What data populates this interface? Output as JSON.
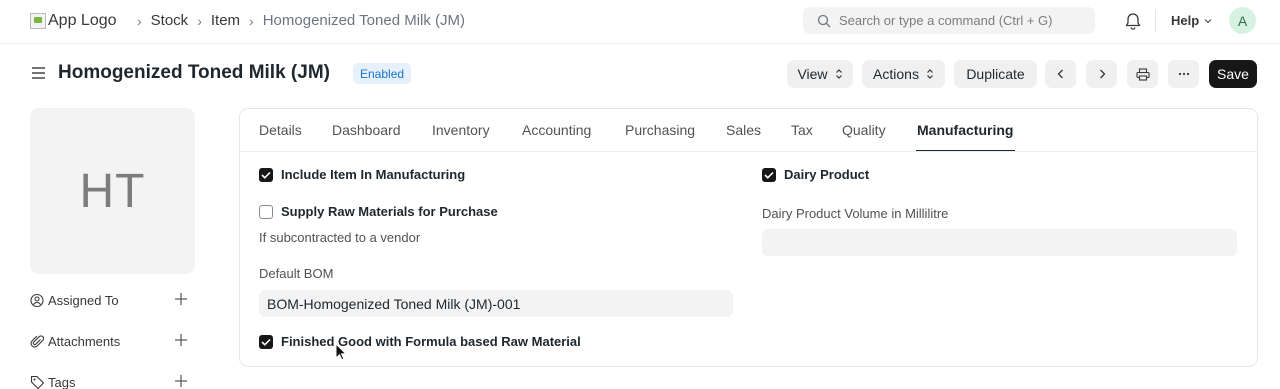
{
  "navbar": {
    "logo_alt": "App Logo",
    "breadcrumbs": [
      "Stock",
      "Item",
      "Homogenized Toned Milk (JM)"
    ],
    "search_placeholder": "Search or type a command (Ctrl + G)",
    "help_label": "Help",
    "avatar_initial": "A"
  },
  "page": {
    "title": "Homogenized Toned Milk (JM)",
    "status": "Enabled",
    "buttons": {
      "view": "View",
      "actions": "Actions",
      "duplicate": "Duplicate",
      "save": "Save"
    }
  },
  "sidebar": {
    "image_initials": "HT",
    "items": [
      {
        "label": "Assigned To"
      },
      {
        "label": "Attachments"
      },
      {
        "label": "Tags"
      }
    ]
  },
  "tabs": [
    "Details",
    "Dashboard",
    "Inventory",
    "Accounting",
    "Purchasing",
    "Sales",
    "Tax",
    "Quality",
    "Manufacturing"
  ],
  "active_tab": "Manufacturing",
  "form": {
    "include_in_manufacturing": {
      "label": "Include Item In Manufacturing",
      "checked": true
    },
    "supply_raw_materials": {
      "label": "Supply Raw Materials for Purchase",
      "checked": false,
      "description": "If subcontracted to a vendor"
    },
    "default_bom": {
      "label": "Default BOM",
      "value": "BOM-Homogenized Toned Milk (JM)-001"
    },
    "finished_good_formula": {
      "label": "Finished Good with Formula based Raw Material",
      "checked": true
    },
    "dairy_product": {
      "label": "Dairy Product",
      "checked": true
    },
    "dairy_volume": {
      "label": "Dairy Product Volume in Millilitre",
      "value": ""
    }
  },
  "colors": {
    "accent_dark": "#171717",
    "status_badge_bg": "#e6f1fc",
    "status_badge_text": "#1a73c9",
    "avatar_bg": "#d7f2e3"
  }
}
